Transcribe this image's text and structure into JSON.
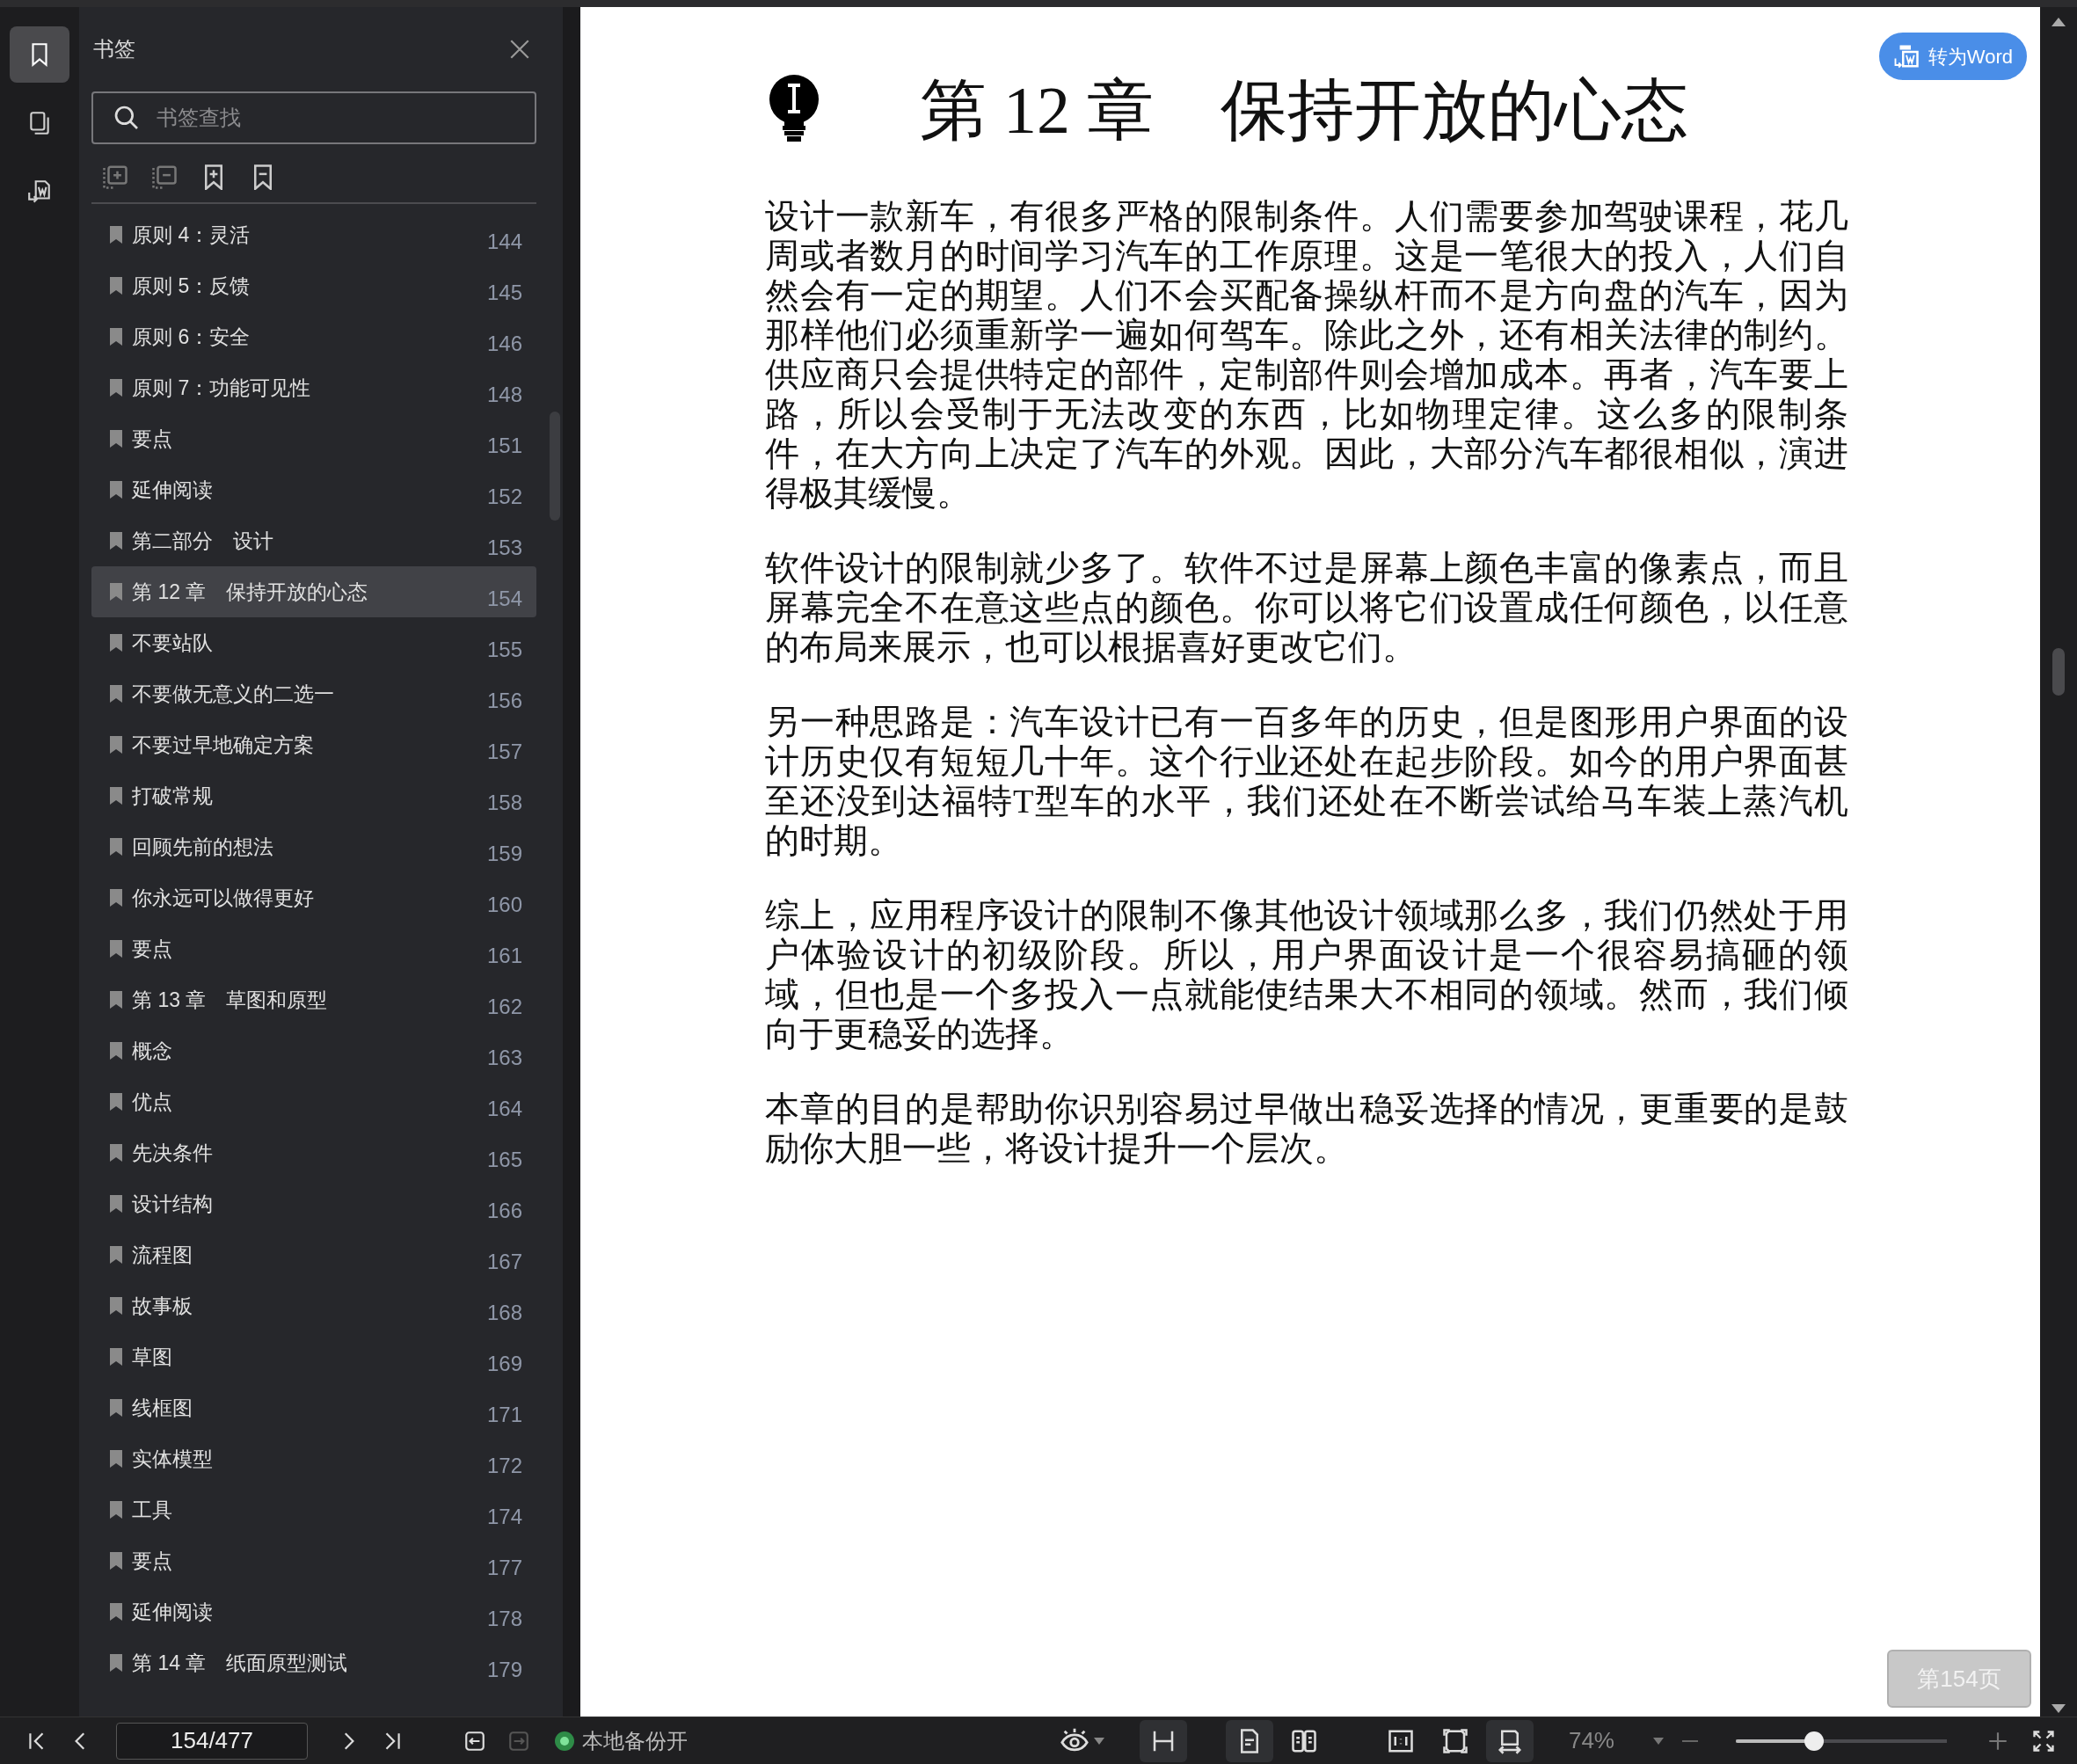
{
  "rail_tabs": [
    {
      "kind": "bookmarks",
      "selected": true
    },
    {
      "kind": "pages",
      "selected": false
    },
    {
      "kind": "convert",
      "selected": false
    }
  ],
  "sidebar": {
    "title": "书签",
    "search": {
      "placeholder": "书签查找"
    },
    "items": [
      {
        "label": "原则 4：灵活",
        "page": "144",
        "selected": false
      },
      {
        "label": "原则 5：反馈",
        "page": "145",
        "selected": false
      },
      {
        "label": "原则 6：安全",
        "page": "146",
        "selected": false
      },
      {
        "label": "原则 7：功能可见性",
        "page": "148",
        "selected": false
      },
      {
        "label": "要点",
        "page": "151",
        "selected": false
      },
      {
        "label": "延伸阅读",
        "page": "152",
        "selected": false
      },
      {
        "label": "第二部分　设计",
        "page": "153",
        "selected": false
      },
      {
        "label": "第 12 章　保持开放的心态",
        "page": "154",
        "selected": true
      },
      {
        "label": "不要站队",
        "page": "155",
        "selected": false
      },
      {
        "label": "不要做无意义的二选一",
        "page": "156",
        "selected": false
      },
      {
        "label": "不要过早地确定方案",
        "page": "157",
        "selected": false
      },
      {
        "label": "打破常规",
        "page": "158",
        "selected": false
      },
      {
        "label": "回顾先前的想法",
        "page": "159",
        "selected": false
      },
      {
        "label": "你永远可以做得更好",
        "page": "160",
        "selected": false
      },
      {
        "label": "要点",
        "page": "161",
        "selected": false
      },
      {
        "label": "第 13 章　草图和原型",
        "page": "162",
        "selected": false
      },
      {
        "label": "概念",
        "page": "163",
        "selected": false
      },
      {
        "label": "优点",
        "page": "164",
        "selected": false
      },
      {
        "label": "先决条件",
        "page": "165",
        "selected": false
      },
      {
        "label": "设计结构",
        "page": "166",
        "selected": false
      },
      {
        "label": "流程图",
        "page": "167",
        "selected": false
      },
      {
        "label": "故事板",
        "page": "168",
        "selected": false
      },
      {
        "label": "草图",
        "page": "169",
        "selected": false
      },
      {
        "label": "线框图",
        "page": "171",
        "selected": false
      },
      {
        "label": "实体模型",
        "page": "172",
        "selected": false
      },
      {
        "label": "工具",
        "page": "174",
        "selected": false
      },
      {
        "label": "要点",
        "page": "177",
        "selected": false
      },
      {
        "label": "延伸阅读",
        "page": "178",
        "selected": false
      },
      {
        "label": "第 14 章　纸面原型测试",
        "page": "179",
        "selected": false
      }
    ]
  },
  "document": {
    "convert_button": "转为Word",
    "chapter_title": "第 12 章　保持开放的心态",
    "paragraphs": [
      "设计一款新车，有很多严格的限制条件。人们需要参加驾驶课程，花几周或者数月的时间学习汽车的工作原理。这是一笔很大的投入，人们自然会有一定的期望。人们不会买配备操纵杆而不是方向盘的汽车，因为那样他们必须重新学一遍如何驾车。除此之外，还有相关法律的制约。供应商只会提供特定的部件，定制部件则会增加成本。再者，汽车要上路，所以会受制于无法改变的东西，比如物理定律。这么多的限制条件，在大方向上决定了汽车的外观。因此，大部分汽车都很相似，演进得极其缓慢。",
      "软件设计的限制就少多了。软件不过是屏幕上颜色丰富的像素点，而且屏幕完全不在意这些点的颜色。你可以将它们设置成任何颜色，以任意的布局来展示，也可以根据喜好更改它们。",
      "另一种思路是：汽车设计已有一百多年的历史，但是图形用户界面的设计历史仅有短短几十年。这个行业还处在起步阶段。如今的用户界面甚至还没到达福特T型车的水平，我们还处在不断尝试给马车装上蒸汽机的时期。",
      "综上，应用程序设计的限制不像其他设计领域那么多，我们仍然处于用户体验设计的初级阶段。所以，用户界面设计是一个很容易搞砸的领域，但也是一个多投入一点就能使结果大不相同的领域。然而，我们倾向于更稳妥的选择。",
      "本章的目的是帮助你识别容易过早做出稳妥选择的情况，更重要的是鼓励你大胆一些，将设计提升一个层次。"
    ],
    "page_badge": "第154页"
  },
  "bottom_bar": {
    "page_field": "154/477",
    "backup": {
      "label": "本地备份开",
      "on": true
    },
    "view_buttons": [
      {
        "kind": "scroll",
        "selected": true
      },
      {
        "kind": "single",
        "selected": true
      },
      {
        "kind": "double",
        "selected": false
      },
      {
        "kind": "actual",
        "selected": false
      },
      {
        "kind": "fit-page",
        "selected": false
      },
      {
        "kind": "fit-width",
        "selected": true
      }
    ],
    "zoom": "74%",
    "zoom_slider": {
      "level": 0.37
    }
  }
}
